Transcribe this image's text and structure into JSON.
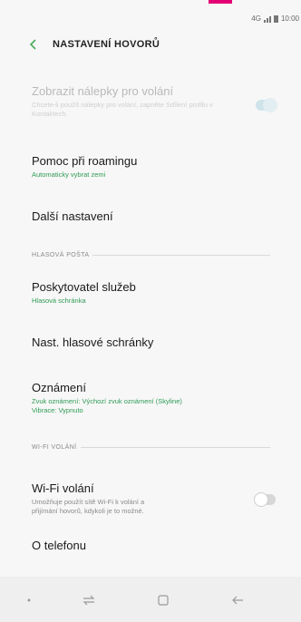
{
  "status_bar": {
    "time": "10:00",
    "network": "4G",
    "accent_color": "#e20074"
  },
  "header": {
    "title": "NASTAVENÍ HOVORŮ",
    "back_icon": "chevron-left-icon"
  },
  "items": {
    "stickers": {
      "title": "Zobrazit nálepky pro volání",
      "subtitle": "Chcete-li použít nálepky pro volání, zapněte Sdílení profilu v Kontaktech.",
      "toggle": "on",
      "enabled": false
    },
    "roaming": {
      "title": "Pomoc při roamingu",
      "subtitle": "Automaticky vybrat zemi"
    },
    "more": {
      "title": "Další nastavení"
    },
    "provider": {
      "title": "Poskytovatel služeb",
      "subtitle": "Hlasová schránka"
    },
    "voicemail_settings": {
      "title": "Nast. hlasové schránky"
    },
    "notifications": {
      "title": "Oznámení",
      "subtitle_line1": "Zvuk oznámení: Výchozí zvuk oznámení (Skyline)",
      "subtitle_line2": "Vibrace: Vypnuto"
    },
    "wifi_calling": {
      "title": "Wi-Fi volání",
      "subtitle_line1": "Umožňuje použít sítě Wi-Fi k volání a",
      "subtitle_line2": "přijímání hovorů, kdykoli je to možné.",
      "toggle": "off"
    },
    "about": {
      "title": "O telefonu"
    }
  },
  "sections": {
    "voicemail": "HLASOVÁ POŠTA",
    "wifi": "WI-FI VOLÁNÍ"
  },
  "colors": {
    "accent_green": "#2f9b55",
    "background": "#f7f7f7"
  }
}
